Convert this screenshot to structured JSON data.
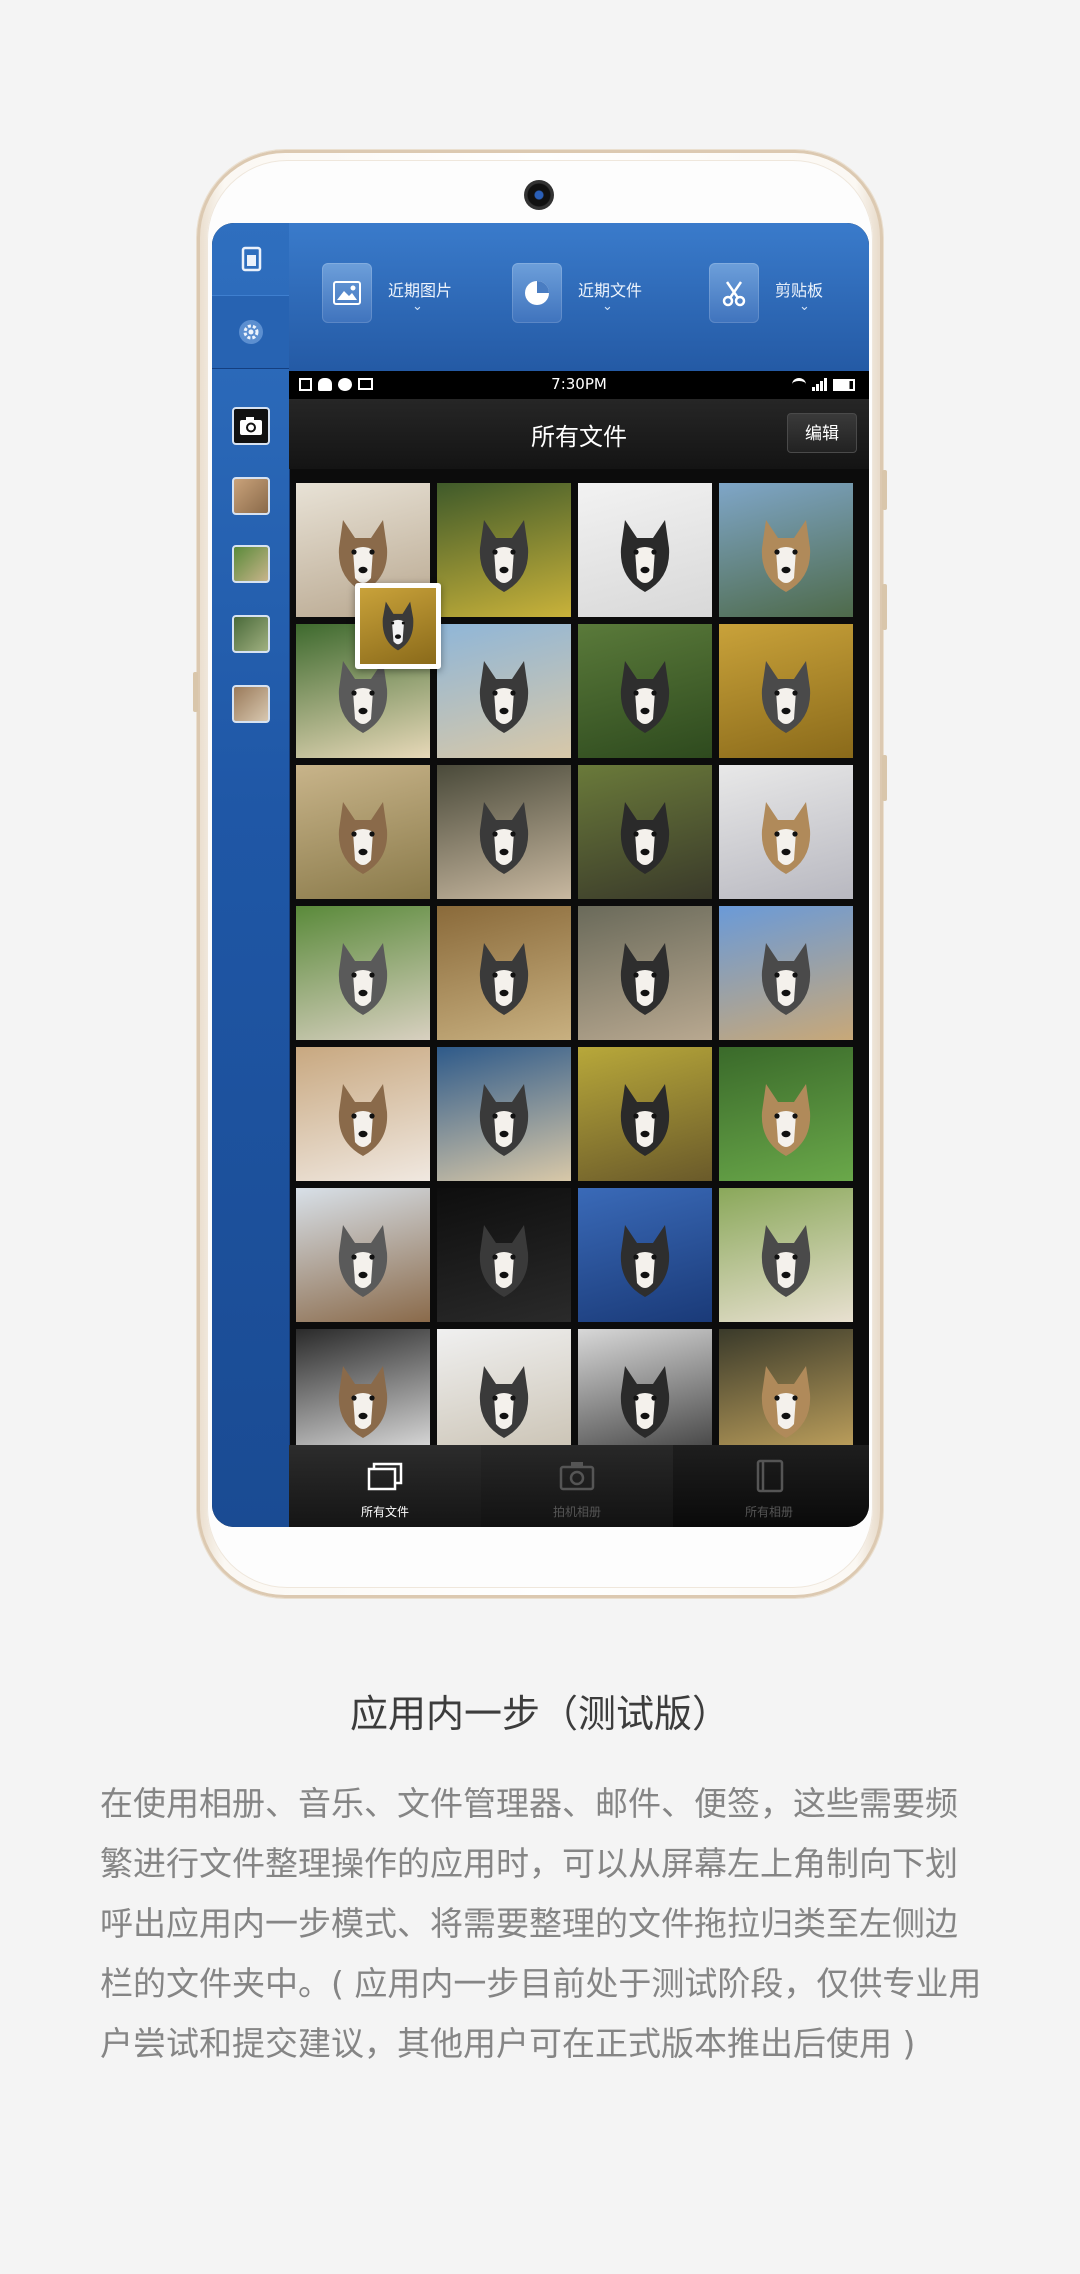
{
  "toolbar": {
    "items": [
      {
        "label": "近期图片",
        "icon": "image-icon"
      },
      {
        "label": "近期文件",
        "icon": "pie-clock-icon"
      },
      {
        "label": "剪贴板",
        "icon": "scissors-icon"
      }
    ]
  },
  "statusbar": {
    "time": "7:30PM"
  },
  "header": {
    "title": "所有文件",
    "edit_label": "编辑"
  },
  "tabs": [
    {
      "label": "所有文件",
      "active": true
    },
    {
      "label": "拍机相册",
      "active": false
    },
    {
      "label": "所有相册",
      "active": false
    }
  ],
  "colors": {
    "accent_blue": "#245aa5",
    "sidebar_blue": "#1f57a6"
  },
  "photos": {
    "count_visible": 28,
    "subject": "husky"
  },
  "text": {
    "heading": "应用内一步（测试版）",
    "description": "在使用相册、音乐、文件管理器、邮件、便签，这些需要频繁进行文件整理操作的应用时，可以从屏幕左上角制向下划呼出应用内一步模式、将需要整理的文件拖拉归类至左侧边栏的文件夹中。( 应用内一步目前处于测试阶段，仅供专业用户尝试和提交建议，其他用户可在正式版本推出后使用 )"
  }
}
